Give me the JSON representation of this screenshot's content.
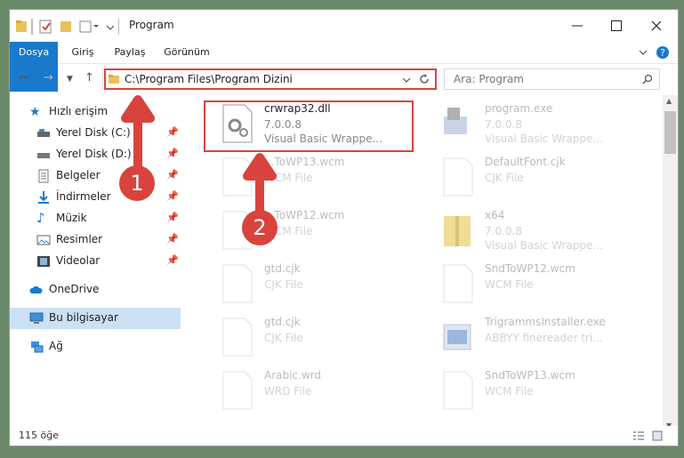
{
  "window": {
    "title": "Program"
  },
  "ribbon": {
    "tabs": [
      {
        "label": "Dosya"
      },
      {
        "label": "Giriş"
      },
      {
        "label": "Paylaş"
      },
      {
        "label": "Görünüm"
      }
    ]
  },
  "address": {
    "path": "C:\\Program Files\\Program Dizini"
  },
  "search": {
    "placeholder": "Ara: Program"
  },
  "sidebar": {
    "items": [
      {
        "label": "Hızlı erişim"
      },
      {
        "label": "Yerel Disk (C:)"
      },
      {
        "label": "Yerel Disk (D:)"
      },
      {
        "label": "Belgeler"
      },
      {
        "label": "İndirmeler"
      },
      {
        "label": "Müzik"
      },
      {
        "label": "Resimler"
      },
      {
        "label": "Videolar"
      },
      {
        "label": "OneDrive"
      },
      {
        "label": "Bu bilgisayar"
      },
      {
        "label": "Ağ"
      }
    ]
  },
  "files": [
    {
      "name": "crwrap32.dll",
      "line2": "7.0.0.8",
      "line3": "Visual Basic Wrappe..."
    },
    {
      "name": "program.exe",
      "line2": "7.0.0.8",
      "line3": "Visual Basic Wrappe..."
    },
    {
      "name": "...ToWP13.wcm",
      "line2": "WCM File",
      "line3": ""
    },
    {
      "name": "DefaultFont.cjk",
      "line2": "CJK File",
      "line3": ""
    },
    {
      "name": "...ToWP12.wcm",
      "line2": "WCM File",
      "line3": ""
    },
    {
      "name": "x64",
      "line2": "7.0.0.8",
      "line3": "Visual Basic Wrappe..."
    },
    {
      "name": "gtd.cjk",
      "line2": "CJK File",
      "line3": ""
    },
    {
      "name": "SndToWP12.wcm",
      "line2": "WCM File",
      "line3": ""
    },
    {
      "name": "gtd.cjk",
      "line2": "CJK File",
      "line3": ""
    },
    {
      "name": "TrigrammsInstaller.exe",
      "line2": "ABBYY finereader tri...",
      "line3": ""
    },
    {
      "name": "Arabic.wrd",
      "line2": "WRD File",
      "line3": ""
    },
    {
      "name": "SndToWP13.wcm",
      "line2": "WCM File",
      "line3": ""
    }
  ],
  "status": {
    "count": "115 öğe"
  },
  "annotations": {
    "marker1": "1",
    "marker2": "2"
  },
  "colors": {
    "accent": "#1979ca",
    "annotation": "#d9433d",
    "selected": "#cce0f4"
  }
}
